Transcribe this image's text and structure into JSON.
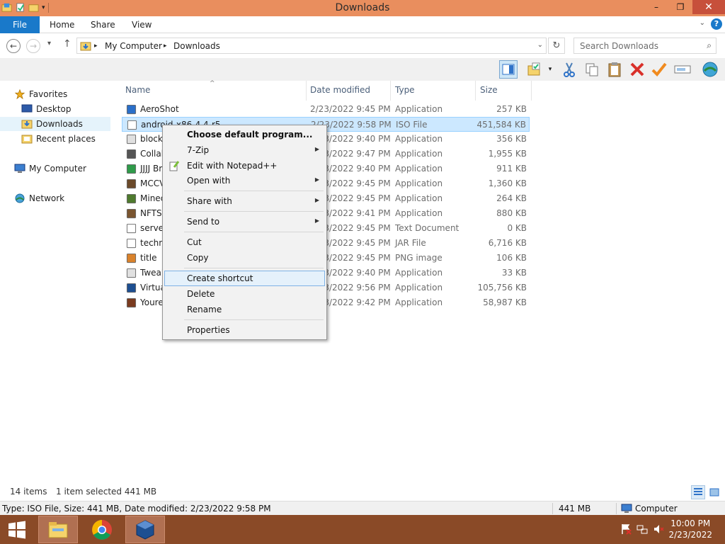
{
  "window": {
    "title": "Downloads",
    "minimize": "–",
    "maximize": "❐",
    "close": "✕"
  },
  "ribbon": {
    "file": "File",
    "home": "Home",
    "share": "Share",
    "view": "View",
    "help": "?",
    "collapse": "⌄"
  },
  "nav": {
    "back": "←",
    "forward": "→",
    "recent": "▾",
    "up": "↑",
    "refresh": "↻"
  },
  "address": {
    "root": "My Computer",
    "current": "Downloads",
    "sep": "▸",
    "dropdown": "⌄"
  },
  "search": {
    "placeholder": "Search Downloads",
    "icon": "⌕"
  },
  "sidebar": {
    "favorites": "Favorites",
    "desktop": "Desktop",
    "downloads": "Downloads",
    "recent": "Recent places",
    "computer": "My Computer",
    "network": "Network"
  },
  "columns": {
    "name": "Name",
    "date": "Date modified",
    "type": "Type",
    "size": "Size",
    "sort": "^"
  },
  "files": [
    {
      "name": "AeroShot",
      "date": "2/23/2022 9:45 PM",
      "type": "Application",
      "size": "257 KB",
      "icon": "aeroshot-icon",
      "color": "#2a6fc9"
    },
    {
      "name": "android-x86-4.4-r5",
      "date": "2/23/2022 9:58 PM",
      "type": "ISO File",
      "size": "451,584 KB",
      "icon": "iso-file-icon",
      "color": "#ffffff"
    },
    {
      "name": "blocks",
      "date": "2/23/2022 9:40 PM",
      "type": "Application",
      "size": "356 KB",
      "icon": "app-window-icon",
      "color": "#e0e0e0"
    },
    {
      "name": "Collab",
      "date": "2/23/2022 9:47 PM",
      "type": "Application",
      "size": "1,955 KB",
      "icon": "gear-app-icon",
      "color": "#555555"
    },
    {
      "name": "JJJJ Br",
      "date": "2/23/2022 9:40 PM",
      "type": "Application",
      "size": "911 KB",
      "icon": "globe-icon",
      "color": "#2f9b4a"
    },
    {
      "name": "MCCV",
      "date": "2/23/2022 9:45 PM",
      "type": "Application",
      "size": "1,360 KB",
      "icon": "block-icon",
      "color": "#6b4a2a"
    },
    {
      "name": "Minec",
      "date": "2/23/2022 9:45 PM",
      "type": "Application",
      "size": "264 KB",
      "icon": "grass-block-icon",
      "color": "#4f7a2e"
    },
    {
      "name": "NFTSt",
      "date": "2/23/2022 9:41 PM",
      "type": "Application",
      "size": "880 KB",
      "icon": "block-icon",
      "color": "#7a5530"
    },
    {
      "name": "server",
      "date": "2/23/2022 9:45 PM",
      "type": "Text Document",
      "size": "0 KB",
      "icon": "text-document-icon",
      "color": "#ffffff"
    },
    {
      "name": "techn",
      "date": "2/23/2022 9:45 PM",
      "type": "JAR File",
      "size": "6,716 KB",
      "icon": "jar-file-icon",
      "color": "#ffffff"
    },
    {
      "name": "title",
      "date": "2/23/2022 9:45 PM",
      "type": "PNG image",
      "size": "106 KB",
      "icon": "png-image-icon",
      "color": "#d9822b"
    },
    {
      "name": "Tweak",
      "date": "2/23/2022 9:40 PM",
      "type": "Application",
      "size": "33 KB",
      "icon": "app-window-icon",
      "color": "#e0e0e0"
    },
    {
      "name": "Virtua",
      "date": "2/23/2022 9:56 PM",
      "type": "Application",
      "size": "105,756 KB",
      "icon": "virtualbox-icon",
      "color": "#1d4f91"
    },
    {
      "name": "Youre",
      "date": "2/23/2022 9:42 PM",
      "type": "Application",
      "size": "58,987 KB",
      "icon": "person-icon",
      "color": "#7a3b1f"
    }
  ],
  "context_menu": {
    "choose_default": "Choose default program...",
    "zip": "7-Zip",
    "notepad": "Edit with Notepad++",
    "open_with": "Open with",
    "share_with": "Share with",
    "send_to": "Send to",
    "cut": "Cut",
    "copy": "Copy",
    "create_shortcut": "Create shortcut",
    "delete": "Delete",
    "rename": "Rename",
    "properties": "Properties",
    "arrow": "▶"
  },
  "status": {
    "items": "14 items",
    "selected": "1 item selected  441 MB",
    "detail": "Type: ISO File, Size: 441 MB, Date modified: 2/23/2022 9:58 PM",
    "size": "441 MB",
    "location": "Computer"
  },
  "taskbar": {
    "time": "10:00 PM",
    "date": "2/23/2022"
  },
  "colors": {
    "titlebar": "#e98e5e",
    "accent": "#1979ca",
    "taskbar": "#8a4a27",
    "selection": "#cce8ff"
  }
}
